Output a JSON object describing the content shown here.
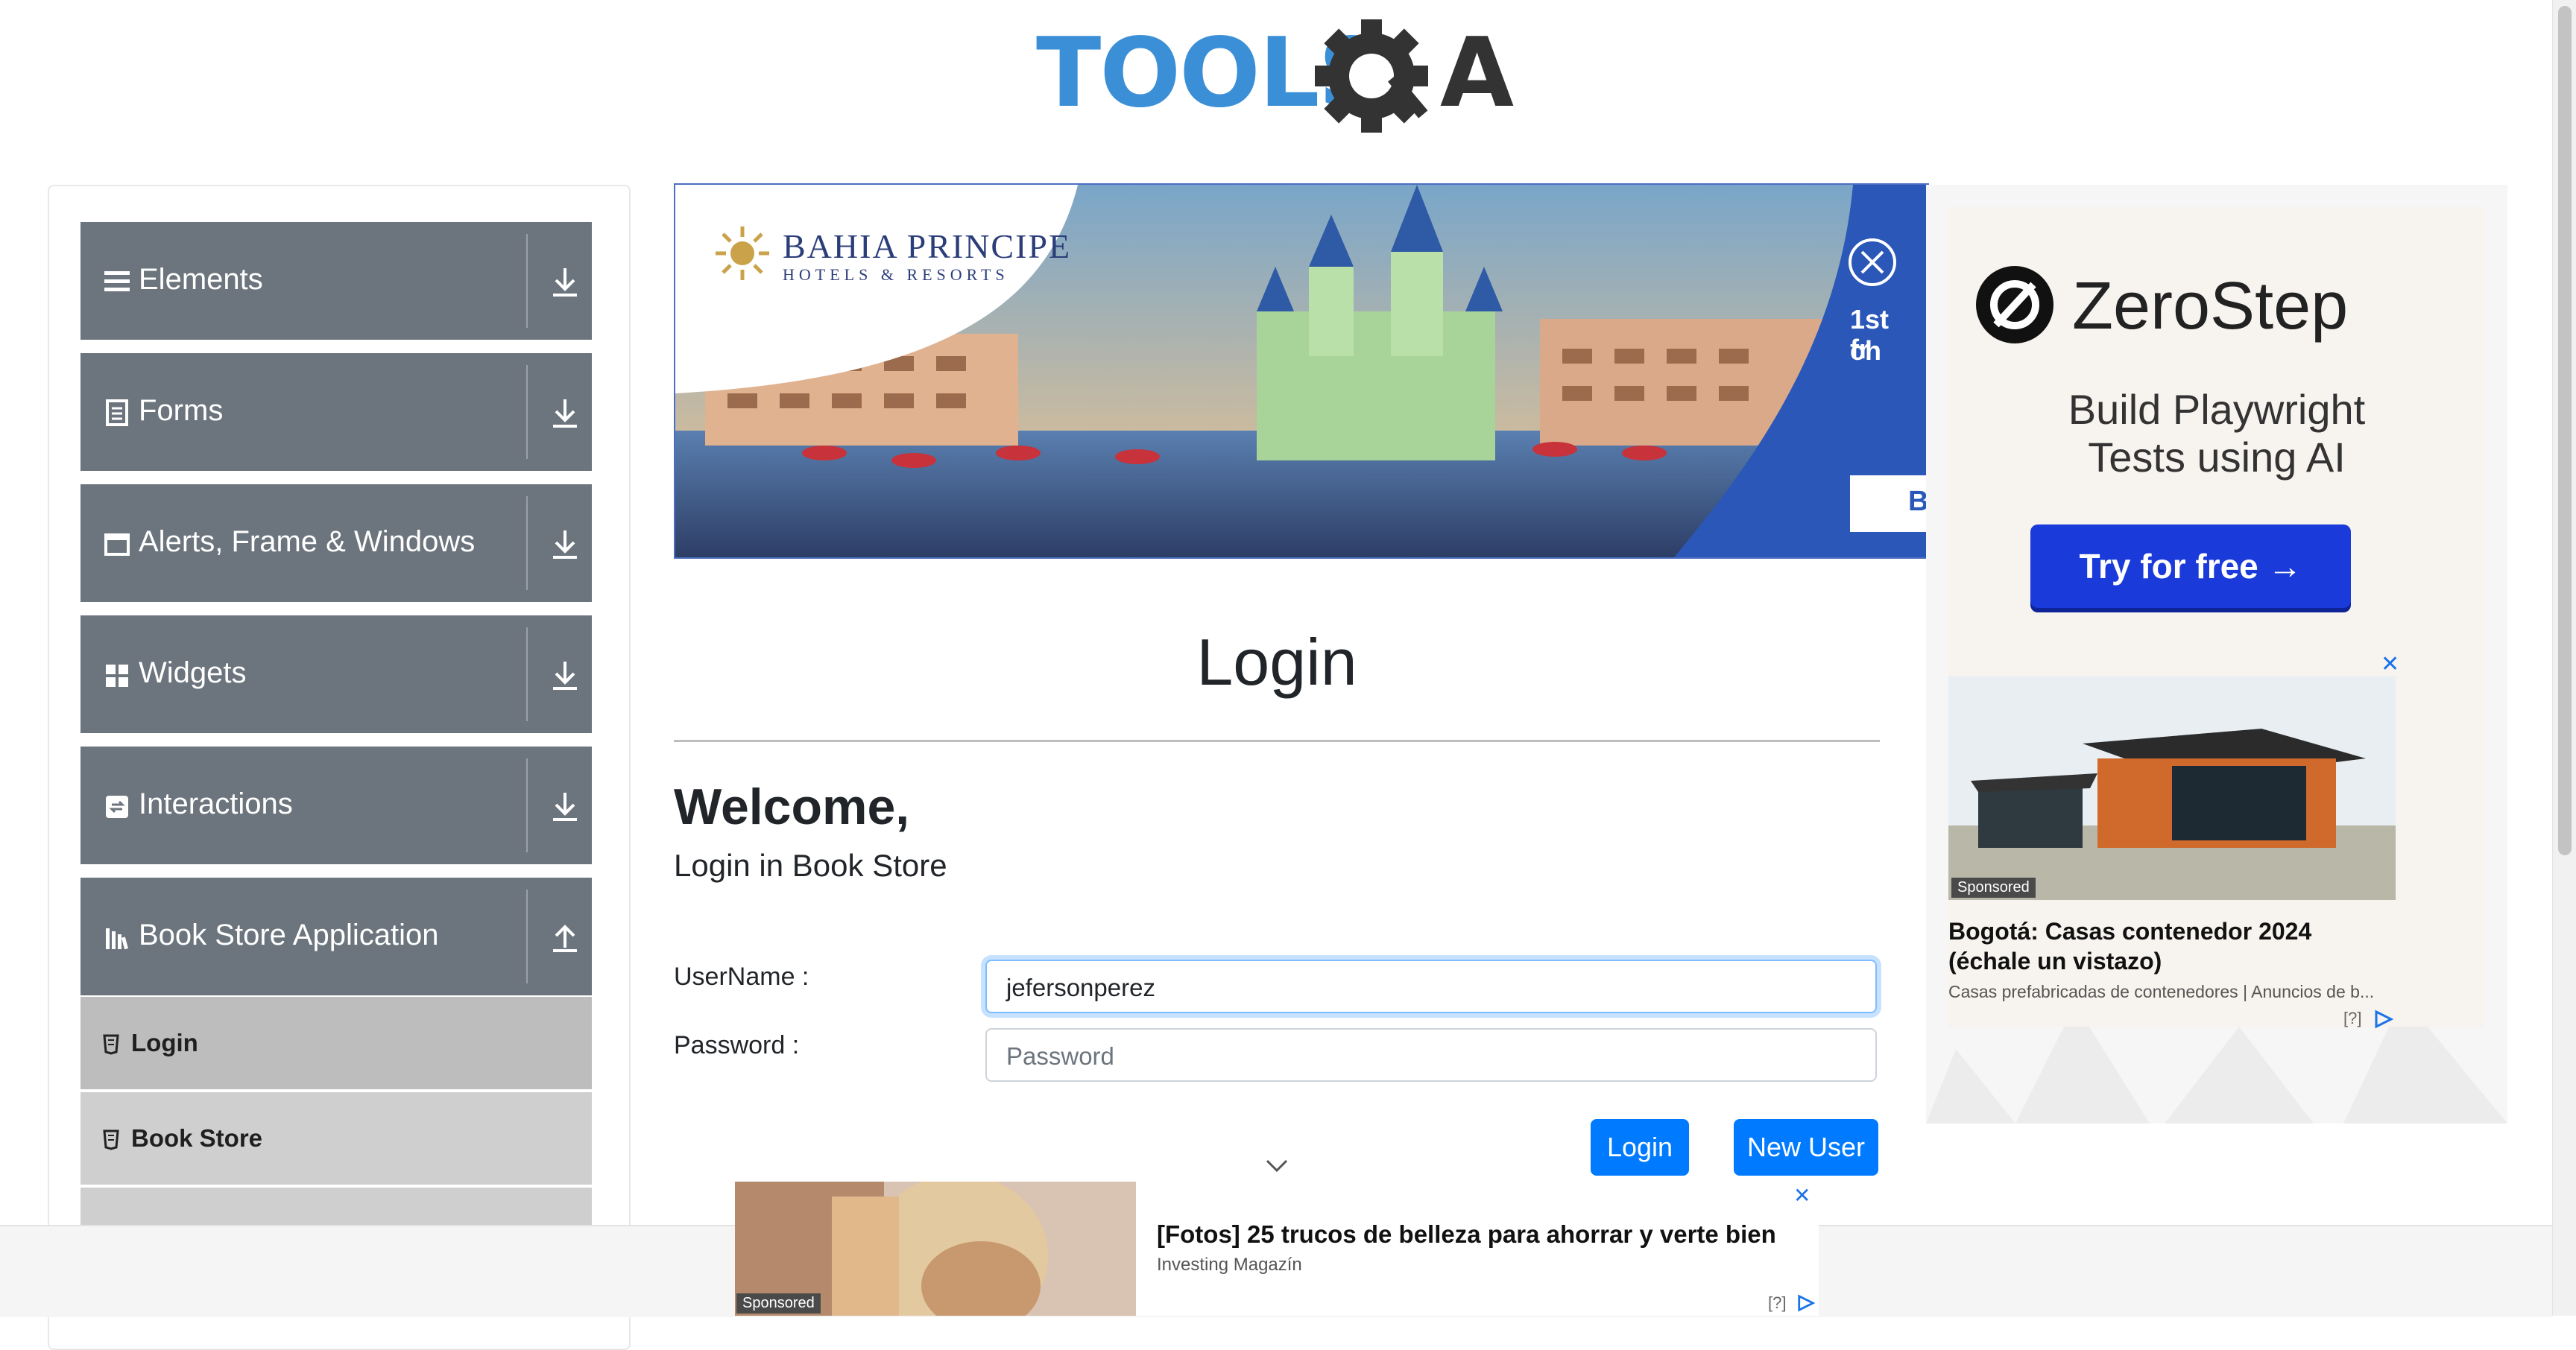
{
  "header": {
    "logo_text_tools": "TOOLS",
    "logo_text_a": "A",
    "logo_alt": "TOOLSQA"
  },
  "sidebar": {
    "groups": [
      {
        "label": "Elements",
        "icon": "list-icon"
      },
      {
        "label": "Forms",
        "icon": "document-icon"
      },
      {
        "label": "Alerts, Frame & Windows",
        "icon": "window-icon"
      },
      {
        "label": "Widgets",
        "icon": "widgets-icon"
      },
      {
        "label": "Interactions",
        "icon": "interactions-icon"
      },
      {
        "label": "Book Store Application",
        "icon": "bookstore-icon"
      }
    ],
    "subitems": [
      {
        "label": "Login",
        "active": true
      },
      {
        "label": "Book Store",
        "active": false
      }
    ]
  },
  "banner": {
    "brand": "BAHIA PRINCIPE",
    "brand_sub": "HOTELS & RESORTS",
    "promo_line1": "1st ch",
    "promo_line2": "fr",
    "cta": "B"
  },
  "right_ad": {
    "brand": "ZeroStep",
    "headline": "Build Playwright Tests using AI",
    "cta": "Try for free →",
    "sponsored": "Sponsored",
    "title": "Bogotá: Casas contenedor 2024 (échale un vistazo)",
    "source": "Casas prefabricadas de contenedores | Anuncios de b...",
    "info": "[?]"
  },
  "login": {
    "title": "Login",
    "welcome": "Welcome,",
    "subtitle": "Login in Book Store",
    "username_label": "UserName :",
    "username_value": "jefersonperez",
    "password_label": "Password :",
    "password_placeholder": "Password",
    "login_button": "Login",
    "new_user_button": "New User"
  },
  "bottom_ad": {
    "sponsored": "Sponsored",
    "title": "[Fotos] 25 trucos de belleza para ahorrar y verte bien",
    "source": "Investing Magazín",
    "info": "[?]"
  },
  "colors": {
    "primary": "#007bff",
    "sidebar_group": "#6c757d",
    "sidebar_sub": "#cfcfcf",
    "logo_blue": "#3a8fd6",
    "logo_dark": "#333333"
  }
}
